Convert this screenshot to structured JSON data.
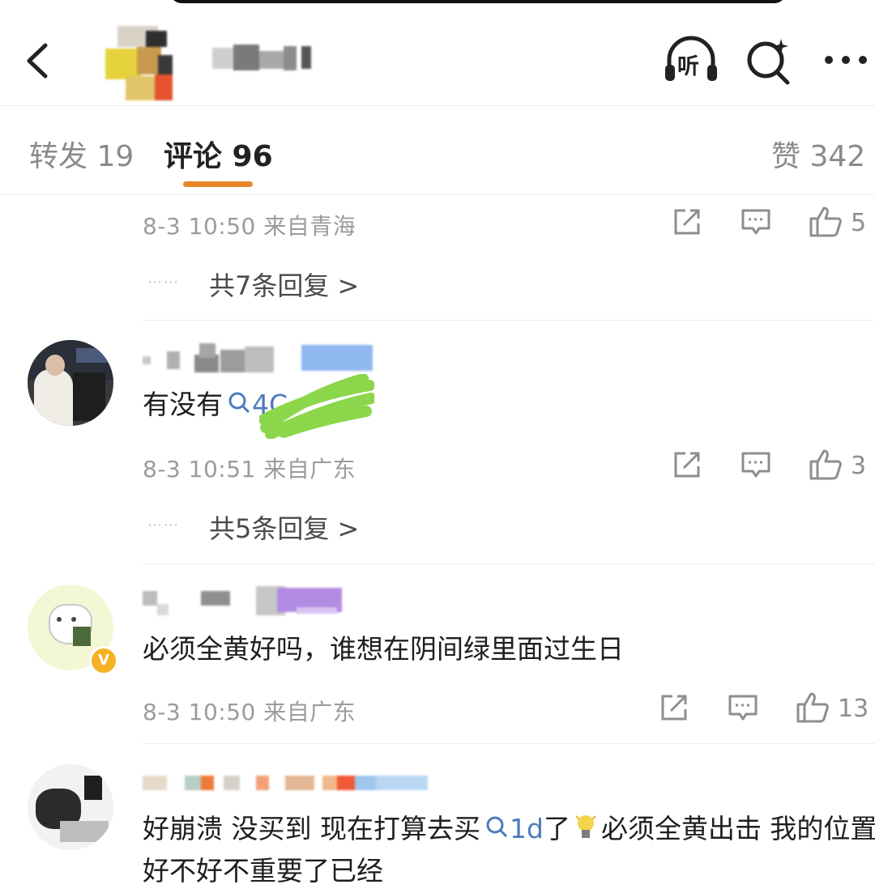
{
  "header": {
    "back_icon": "chevron-left-icon",
    "listen_label": "听",
    "listen_icon": "headphones-icon",
    "search_icon": "search-sparkle-icon",
    "more_icon": "more-icon"
  },
  "tabs": {
    "repost": "转发 19",
    "comments": "评论 96",
    "likes": "赞 342",
    "active_color": "#e8862a"
  },
  "comments": [
    {
      "meta": "8-3 10:50 来自青海",
      "likes": "5",
      "replies": "共7条回复 >"
    },
    {
      "text": "有没有",
      "search_tag": "4C",
      "meta": "8-3 10:51 来自广东",
      "likes": "3",
      "replies": "共5条回复 >"
    },
    {
      "text": "必须全黄好吗，谁想在阴间绿里面过生日",
      "meta": "8-3 10:50 来自广东",
      "likes": "13"
    },
    {
      "text_line1_a": "好崩溃 没买到 现在打算去买",
      "search_tag": "1d",
      "text_line1_b": "了",
      "text_line1_c": "必须全黄出击 我的位置",
      "text_line2": "好不好不重要了已经"
    }
  ],
  "ui": {
    "reply_dots": "⋯⋯",
    "share_icon": "share-icon",
    "comment_icon": "comment-icon",
    "like_icon": "thumbs-up-icon",
    "verified_badge": "V"
  }
}
